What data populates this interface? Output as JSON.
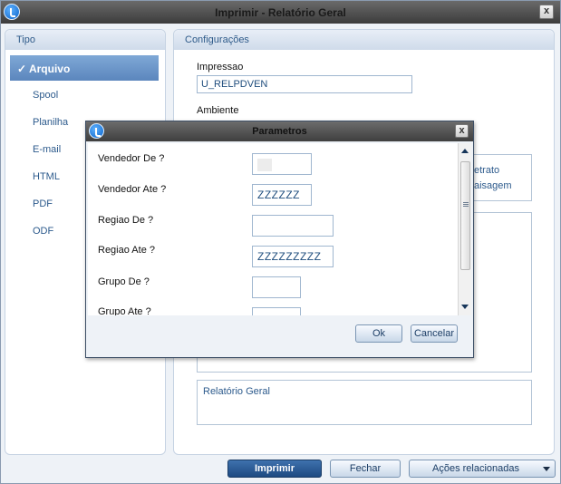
{
  "window": {
    "title": "Imprimir - Relatório Geral",
    "close_glyph": "x"
  },
  "tipo": {
    "header": "Tipo",
    "check_glyph": "✓",
    "items": [
      {
        "label": "Arquivo"
      },
      {
        "label": "Spool"
      },
      {
        "label": "Planilha"
      },
      {
        "label": "E-mail"
      },
      {
        "label": "HTML"
      },
      {
        "label": "PDF"
      },
      {
        "label": "ODF"
      }
    ]
  },
  "config": {
    "header": "Configurações",
    "impressao_label": "Impressao",
    "impressao_value": "U_RELPDVEN",
    "ambiente_label": "Ambiente",
    "retrato_partial": "etrato",
    "paisagem_partial": "aisagem",
    "description": "Relatório Geral"
  },
  "footer": {
    "imprimir": "Imprimir",
    "fechar": "Fechar",
    "acoes": "Ações relacionadas"
  },
  "dialog": {
    "title": "Parametros",
    "close_glyph": "x",
    "params": [
      {
        "label": "Vendedor De ?",
        "value": ""
      },
      {
        "label": "Vendedor Ate ?",
        "value": "ZZZZZZ"
      },
      {
        "label": "Regiao De ?",
        "value": ""
      },
      {
        "label": "Regiao Ate ?",
        "value": "ZZZZZZZZZ"
      },
      {
        "label": "Grupo De ?",
        "value": ""
      },
      {
        "label": "Grupo Ate ?",
        "value": ""
      }
    ],
    "ok": "Ok",
    "cancelar": "Cancelar"
  },
  "colors": {
    "accent": "#1e4a82",
    "selected_tab": "#6a93c8",
    "titlebar": "#4a4a4a"
  }
}
